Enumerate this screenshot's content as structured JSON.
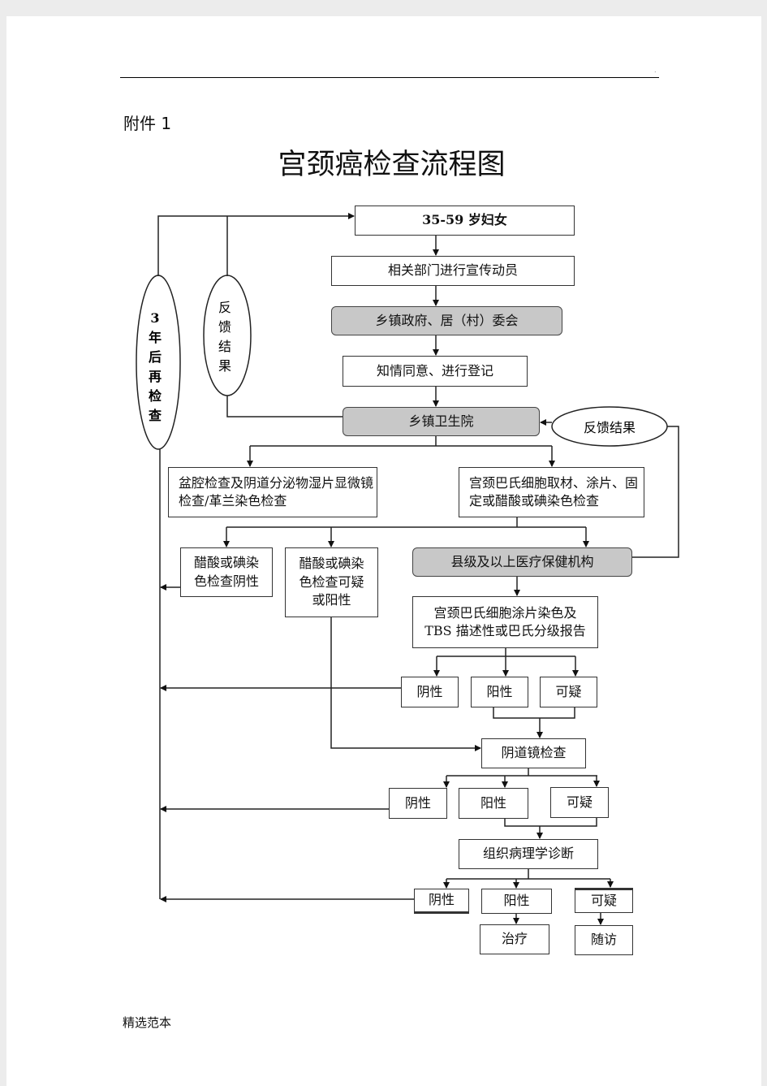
{
  "header": {
    "attachment": "附件 1",
    "title": "宫颈癌检查流程图",
    "dot": "."
  },
  "footer": "精选范本",
  "flow": {
    "women": "35-59 岁妇女",
    "publicity": "相关部门进行宣传动员",
    "gov": "乡镇政府、居（村）委会",
    "consent": "知情同意、进行登记",
    "clinic": "乡镇卫生院",
    "feedback_right": "反馈结果",
    "recheck_3yr": [
      "3",
      "年",
      "后",
      "再",
      "检",
      "查"
    ],
    "feedback_left": [
      "反",
      "馈",
      "结",
      "果"
    ],
    "pelvic": "盆腔检查及阴道分泌物湿片显微镜检查/革兰染色检查",
    "pap_sample": "宫颈巴氏细胞取材、涂片、固定或醋酸或碘染色检查",
    "via_negative": "醋酸或碘染色检查阴性",
    "via_positive": "醋酸或碘染色检查可疑或阳性",
    "county": "县级及以上医疗保健机构",
    "pap_report": "宫颈巴氏细胞涂片染色及TBS 描述性或巴氏分级报告",
    "colposcopy": "阴道镜检查",
    "pathology": "组织病理学诊断",
    "negative": "阴性",
    "positive": "阳性",
    "suspicious": "可疑",
    "treatment": "治疗",
    "followup": "随访"
  }
}
